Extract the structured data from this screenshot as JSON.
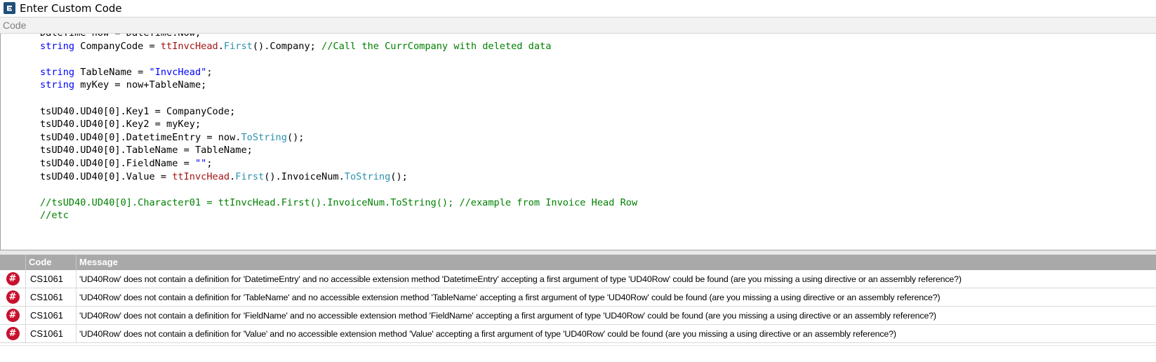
{
  "window": {
    "title": "Enter Custom Code",
    "icon": "app-logo-icon"
  },
  "panel": {
    "header": "Code"
  },
  "colors": {
    "keyword": "#0000ff",
    "type": "#2b91af",
    "string": "#a31515",
    "comment": "#008000",
    "error": "#c8102e",
    "grid_header": "#a9a9a9"
  },
  "code_lines": [
    [
      {
        "t": "DateTime now = DateTime.Now;",
        "c": ""
      }
    ],
    [
      {
        "t": "string",
        "c": "kw"
      },
      {
        "t": " CompanyCode = ",
        "c": ""
      },
      {
        "t": "ttInvcHead",
        "c": "str"
      },
      {
        "t": ".",
        "c": ""
      },
      {
        "t": "First",
        "c": "ty"
      },
      {
        "t": "().Company; ",
        "c": ""
      },
      {
        "t": "//Call the CurrCompany with deleted data",
        "c": "cm"
      }
    ],
    [
      {
        "t": "",
        "c": ""
      }
    ],
    [
      {
        "t": "string",
        "c": "kw"
      },
      {
        "t": " TableName = ",
        "c": ""
      },
      {
        "t": "\"InvcHead\"",
        "c": "kw"
      },
      {
        "t": ";",
        "c": ""
      }
    ],
    [
      {
        "t": "string",
        "c": "kw"
      },
      {
        "t": " myKey = now+TableName;",
        "c": ""
      }
    ],
    [
      {
        "t": "",
        "c": ""
      }
    ],
    [
      {
        "t": "tsUD40.UD40[0].Key1 = CompanyCode;",
        "c": ""
      }
    ],
    [
      {
        "t": "tsUD40.UD40[0].Key2 = myKey;",
        "c": ""
      }
    ],
    [
      {
        "t": "tsUD40.UD40[0].DatetimeEntry = now.",
        "c": ""
      },
      {
        "t": "ToString",
        "c": "ty"
      },
      {
        "t": "();",
        "c": ""
      }
    ],
    [
      {
        "t": "tsUD40.UD40[0].TableName = TableName;",
        "c": ""
      }
    ],
    [
      {
        "t": "tsUD40.UD40[0].FieldName = ",
        "c": ""
      },
      {
        "t": "\"\"",
        "c": "kw"
      },
      {
        "t": ";",
        "c": ""
      }
    ],
    [
      {
        "t": "tsUD40.UD40[0].Value = ",
        "c": ""
      },
      {
        "t": "ttInvcHead",
        "c": "str"
      },
      {
        "t": ".",
        "c": ""
      },
      {
        "t": "First",
        "c": "ty"
      },
      {
        "t": "().InvoiceNum.",
        "c": ""
      },
      {
        "t": "ToString",
        "c": "ty"
      },
      {
        "t": "();",
        "c": ""
      }
    ],
    [
      {
        "t": "",
        "c": ""
      }
    ],
    [
      {
        "t": "//tsUD40.UD40[0].Character01 = ttInvcHead.First().InvoiceNum.ToString(); //example from Invoice Head Row",
        "c": "cm"
      }
    ],
    [
      {
        "t": "//etc",
        "c": "cm"
      }
    ]
  ],
  "errors_grid": {
    "columns": [
      "",
      "Code",
      "Message"
    ],
    "rows": [
      {
        "icon": "error-icon",
        "code": "CS1061",
        "message": "'UD40Row' does not contain a definition for 'DatetimeEntry' and no accessible extension method 'DatetimeEntry' accepting a first argument of type 'UD40Row' could be found (are you missing a using directive or an assembly reference?)"
      },
      {
        "icon": "error-icon",
        "code": "CS1061",
        "message": "'UD40Row' does not contain a definition for 'TableName' and no accessible extension method 'TableName' accepting a first argument of type 'UD40Row' could be found (are you missing a using directive or an assembly reference?)"
      },
      {
        "icon": "error-icon",
        "code": "CS1061",
        "message": "'UD40Row' does not contain a definition for 'FieldName' and no accessible extension method 'FieldName' accepting a first argument of type 'UD40Row' could be found (are you missing a using directive or an assembly reference?)"
      },
      {
        "icon": "error-icon",
        "code": "CS1061",
        "message": "'UD40Row' does not contain a definition for 'Value' and no accessible extension method 'Value' accepting a first argument of type 'UD40Row' could be found (are you missing a using directive or an assembly reference?)"
      }
    ]
  }
}
